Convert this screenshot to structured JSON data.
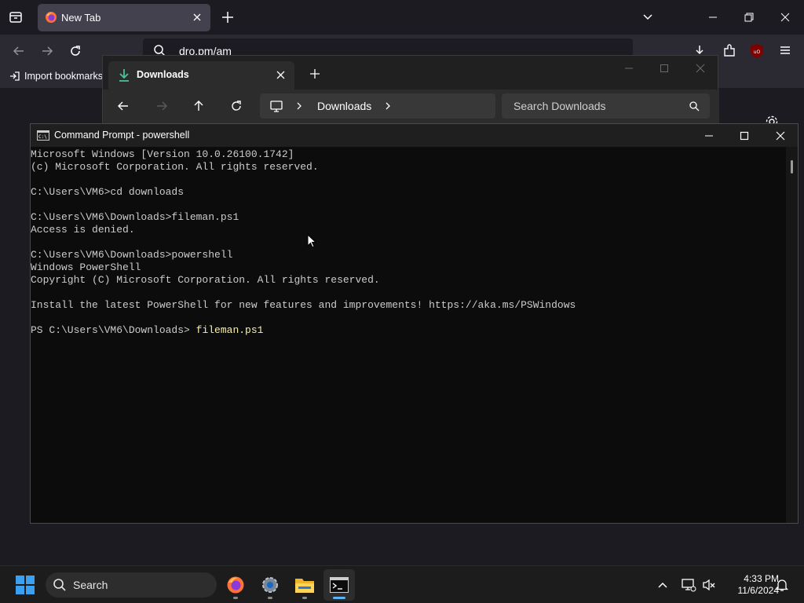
{
  "browser": {
    "tab_title": "New Tab",
    "url_text": "dro.pm/am",
    "bookmarks_item": "Import bookmarks...",
    "colors": {
      "bg": "#1c1b22",
      "toolbar": "#2b2a33",
      "tab": "#42414d",
      "ublock": "#800000"
    }
  },
  "explorer": {
    "tab_title": "Downloads",
    "breadcrumb": "Downloads",
    "search_placeholder": "Search Downloads",
    "accent": "#4cc2a0"
  },
  "cmd": {
    "title": "Command Prompt - powershell",
    "lines": [
      "Microsoft Windows [Version 10.0.26100.1742]",
      "(c) Microsoft Corporation. All rights reserved.",
      "",
      "C:\\Users\\VM6>cd downloads",
      "",
      "C:\\Users\\VM6\\Downloads>fileman.ps1",
      "Access is denied.",
      "",
      "C:\\Users\\VM6\\Downloads>powershell",
      "Windows PowerShell",
      "Copyright (C) Microsoft Corporation. All rights reserved.",
      "",
      "Install the latest PowerShell for new features and improvements! https://aka.ms/PSWindows",
      ""
    ],
    "prompt": "PS C:\\Users\\VM6\\Downloads> ",
    "current_command": "fileman.ps1"
  },
  "taskbar": {
    "search_label": "Search",
    "time": "4:33 PM",
    "date": "11/6/2024",
    "apps": [
      "firefox",
      "settings",
      "file-explorer",
      "command-prompt"
    ]
  }
}
